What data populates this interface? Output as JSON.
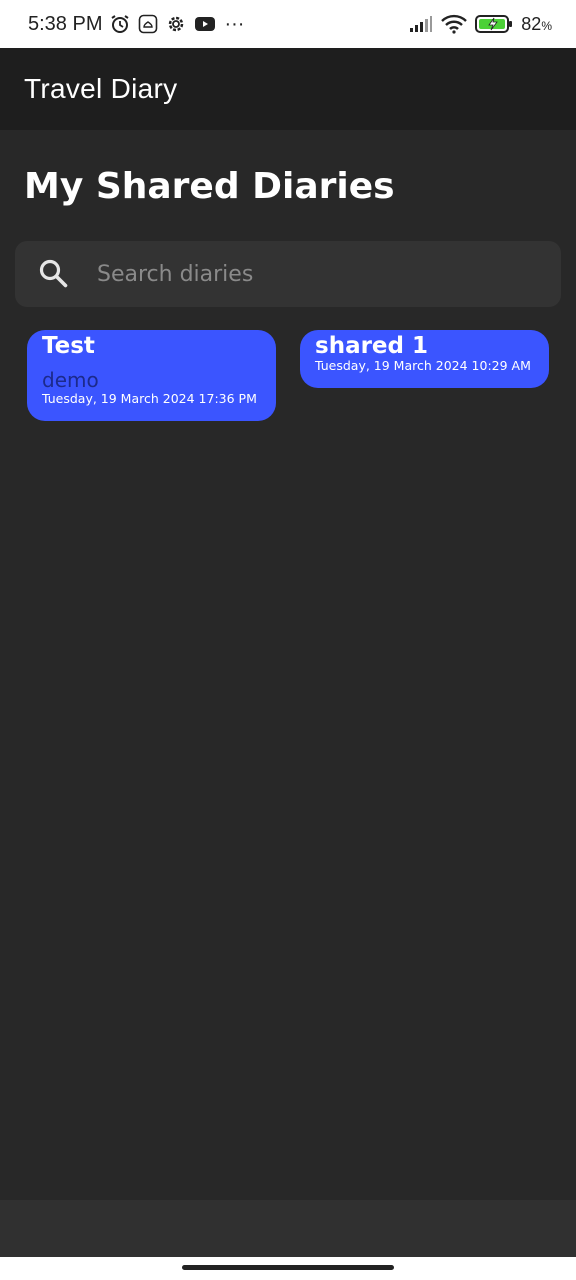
{
  "status_bar": {
    "time": "5:38 PM",
    "more": "···",
    "battery": "82",
    "battery_unit": "%",
    "icons": [
      "alarm-icon",
      "cloud-app-icon",
      "settings-gear-icon",
      "youtube-icon",
      "signal-icon",
      "wifi-icon",
      "battery-charging-icon"
    ]
  },
  "app_bar": {
    "title": "Travel Diary"
  },
  "page": {
    "title": "My Shared Diaries"
  },
  "search": {
    "placeholder": "Search diaries",
    "value": ""
  },
  "diaries": [
    {
      "title": "Test",
      "description": "demo",
      "date": "Tuesday, 19 March 2024 17:36 PM"
    },
    {
      "title": "shared 1",
      "date": "Tuesday, 19 March 2024 10:29 AM"
    }
  ],
  "colors": {
    "background": "#282828",
    "app_bar": "#1e1e1e",
    "card": "#3b55ff",
    "card_desc": "#1c2a8c",
    "search_bg": "#333333"
  }
}
